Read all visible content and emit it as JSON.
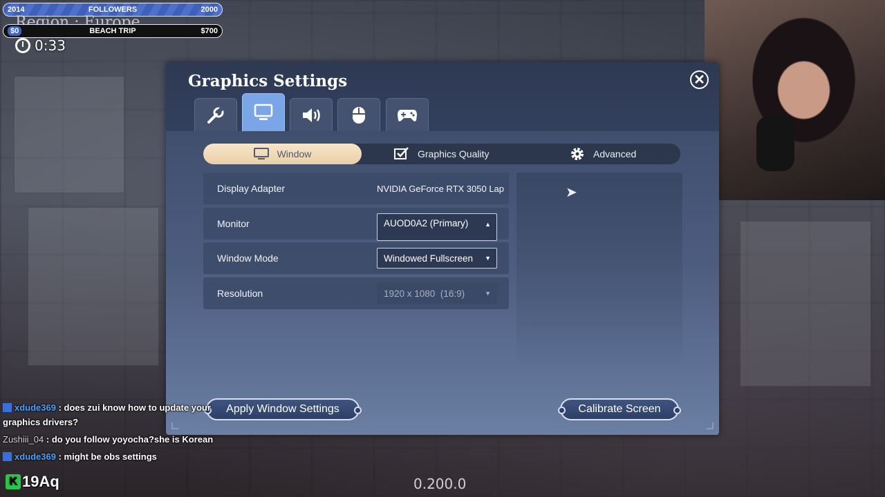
{
  "overlay": {
    "followers_bar": {
      "left": "2014",
      "label": "FOLLOWERS",
      "right": "2000"
    },
    "goal_bar": {
      "left": "$0",
      "label": "BEACH TRIP",
      "right": "$700"
    },
    "region": "Region : Europe",
    "timer": "0:33",
    "version": "0.200.0",
    "badge": {
      "icon": "K",
      "text": "19Aq"
    },
    "chat": [
      {
        "user": "xdude369",
        "message": ": does zui know how to update your graphics drivers?"
      },
      {
        "user": "Zushiii_04",
        "message": ": do you follow yoyocha?she is Korean"
      },
      {
        "user": "xdude369",
        "message": ": might be obs settings"
      }
    ]
  },
  "settings": {
    "title": "Graphics Settings",
    "close_icon": "✕",
    "category_tabs": [
      {
        "name": "general",
        "icon": "wrench-icon"
      },
      {
        "name": "display",
        "icon": "monitor-icon",
        "active": true
      },
      {
        "name": "audio",
        "icon": "speaker-icon"
      },
      {
        "name": "mouse",
        "icon": "mouse-icon"
      },
      {
        "name": "controller",
        "icon": "gamepad-icon"
      }
    ],
    "subtabs": [
      {
        "label": "Window",
        "active": true
      },
      {
        "label": "Graphics Quality"
      },
      {
        "label": "Advanced"
      }
    ],
    "rows": {
      "display_adapter": {
        "label": "Display Adapter",
        "value": "NVIDIA GeForce RTX 3050 Lap"
      },
      "monitor": {
        "label": "Monitor",
        "value": "AUOD0A2 (Primary)"
      },
      "window_mode": {
        "label": "Window Mode",
        "value": "Windowed Fullscreen"
      },
      "resolution": {
        "label": "Resolution",
        "value": "1920 x 1080  (16:9)"
      }
    },
    "buttons": {
      "apply": "Apply Window Settings",
      "calibrate": "Calibrate Screen"
    },
    "colors": {
      "active_tab": "#7aa6e8",
      "active_subtab": "#f1ddbb",
      "panel": "#3a4766"
    }
  }
}
